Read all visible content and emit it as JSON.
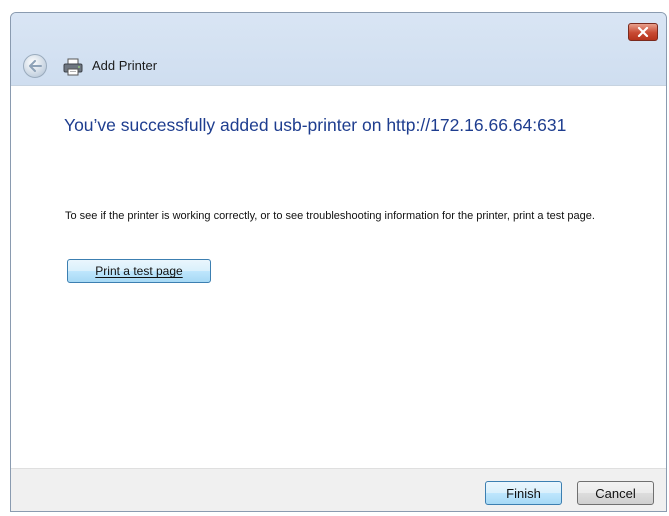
{
  "window": {
    "title": "Add Printer",
    "close_icon": "close-icon",
    "back_icon": "back-arrow-icon",
    "printer_icon": "printer-icon"
  },
  "main": {
    "heading": "You’ve successfully added usb-printer on http://172.16.66.64:631",
    "description": "To see if the printer is working correctly, or to see troubleshooting information for the printer, print a test page.",
    "test_button_label": "Print a test page"
  },
  "footer": {
    "finish_label": "Finish",
    "cancel_label": "Cancel"
  },
  "colors": {
    "heading": "#1e3d8f",
    "close_button": "#c84a33",
    "titlebar": "#d9e5f4",
    "footer": "#f0f0f0"
  }
}
